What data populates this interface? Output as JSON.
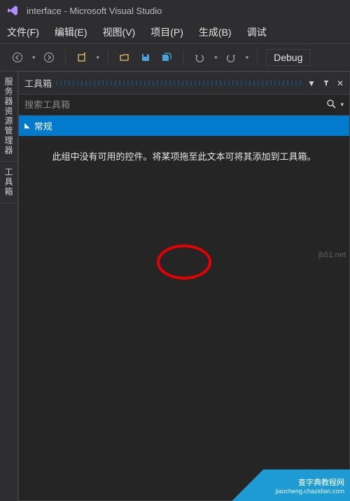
{
  "title_bar": {
    "app_title": "interface - Microsoft Visual Studio"
  },
  "menu": {
    "file": "文件(F)",
    "edit": "编辑(E)",
    "view": "视图(V)",
    "project": "项目(P)",
    "build": "生成(B)",
    "debug": "调试"
  },
  "toolbar": {
    "debug_label": "Debug"
  },
  "side_tabs": {
    "server_explorer": "服务器资源管理器",
    "toolbox": "工具箱"
  },
  "toolbox_panel": {
    "title": "工具箱",
    "search_placeholder": "搜索工具箱",
    "section_general": "常规",
    "empty_message": "此组中没有可用的控件。将某项拖至此文本可将其添加到工具箱。"
  },
  "watermarks": {
    "top": "jb51.net",
    "banner_line1": "查字典教程网",
    "banner_line2": "jiaocheng.chazidian.com"
  }
}
